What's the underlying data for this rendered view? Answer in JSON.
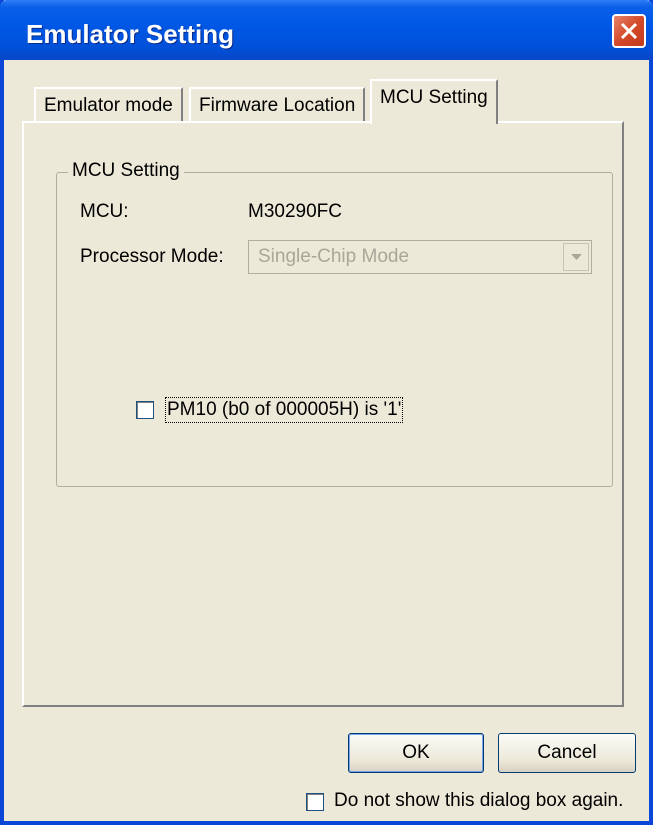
{
  "window": {
    "title": "Emulator Setting"
  },
  "tabs": [
    {
      "label": "Emulator mode"
    },
    {
      "label": "Firmware Location"
    },
    {
      "label": "MCU Setting"
    }
  ],
  "group": {
    "title": "MCU Setting",
    "mcu_label": "MCU:",
    "mcu_value": "M30290FC",
    "processor_mode_label": "Processor Mode:",
    "processor_mode_value": "Single-Chip Mode",
    "pm10_label": "PM10 (b0 of 000005H) is '1'",
    "pm10_checked": false
  },
  "buttons": {
    "ok": "OK",
    "cancel": "Cancel"
  },
  "footer": {
    "dont_show_label": "Do not show this dialog box again.",
    "dont_show_checked": false
  },
  "colors": {
    "titlebar": "#0058e6",
    "close": "#d44a2a",
    "disabled_text": "#a9a79a"
  }
}
